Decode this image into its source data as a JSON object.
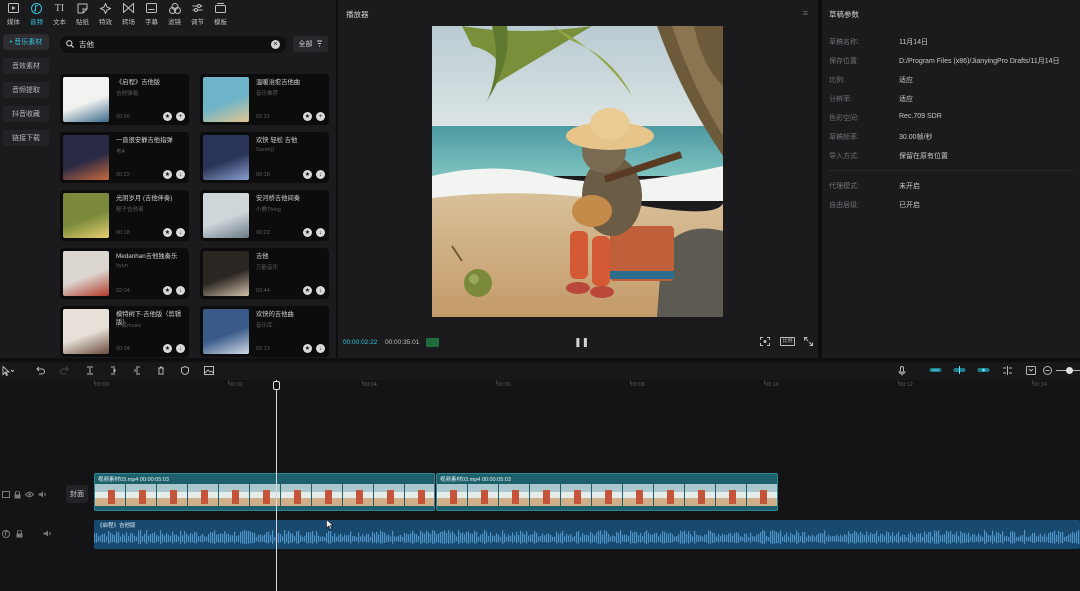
{
  "toolbar": {
    "items": [
      {
        "label": "媒体",
        "icon": "media-icon"
      },
      {
        "label": "音频",
        "icon": "audio-icon"
      },
      {
        "label": "文本",
        "icon": "text-icon"
      },
      {
        "label": "贴纸",
        "icon": "sticker-icon"
      },
      {
        "label": "特效",
        "icon": "effects-icon"
      },
      {
        "label": "转场",
        "icon": "transition-icon"
      },
      {
        "label": "字幕",
        "icon": "caption-icon"
      },
      {
        "label": "滤镜",
        "icon": "filter-icon"
      },
      {
        "label": "调节",
        "icon": "adjust-icon"
      },
      {
        "label": "模板",
        "icon": "template-icon"
      }
    ],
    "active_index": 1,
    "accent": "#33c6d8"
  },
  "sidebar": {
    "items": [
      "• 音乐素材",
      "音效素材",
      "音频提取",
      "抖音收藏",
      "链接下载"
    ]
  },
  "search": {
    "value": "吉他",
    "filter_label": "全部"
  },
  "media": {
    "cards": [
      {
        "title": "《启程》吉他版",
        "sub": "吉他弹唱",
        "dur": "00:56"
      },
      {
        "title": "温暖治愈吉他曲",
        "sub": "音乐推荐",
        "dur": "02:31"
      },
      {
        "title": "一直很安静吉他指弹",
        "sub": "老A",
        "dur": "00:22"
      },
      {
        "title": "欢快 轻松 吉他",
        "sub": "Sanm()",
        "dur": "00:16"
      },
      {
        "title": "光阴岁月 (吉他伴奏)",
        "sub": "郁子吉他谱",
        "dur": "00:18"
      },
      {
        "title": "安河桥吉他间奏",
        "sub": "小鹿Thing",
        "dur": "00:22"
      },
      {
        "title": "Medanhan吉他独奏乐",
        "sub": "hyun",
        "dur": "02:04"
      },
      {
        "title": "吉他",
        "sub": "万能音乐",
        "dur": "03:44"
      },
      {
        "title": "模特树下-吉他版（剪辑版）",
        "sub": "小黄music",
        "dur": "00:34"
      },
      {
        "title": "欢快的吉他曲",
        "sub": "音乐库",
        "dur": "02:13"
      }
    ]
  },
  "player": {
    "title": "播放器",
    "current_time": "00:00:02:22",
    "total_time": "00:00:35:01",
    "ratio_label": "比例"
  },
  "params": {
    "title": "草稿参数",
    "rows": [
      {
        "k": "草稿名称:",
        "v": "11月14日"
      },
      {
        "k": "保存位置:",
        "v": "D:/Program Files (x86)/JianyingPro Drafts/11月14日"
      },
      {
        "k": "比例:",
        "v": "适应"
      },
      {
        "k": "分辨率:",
        "v": "适应"
      },
      {
        "k": "色彩空间:",
        "v": "Rec.709 SDR"
      },
      {
        "k": "草稿帧率:",
        "v": "30.00帧/秒"
      },
      {
        "k": "导入方式:",
        "v": "保留在原有位置"
      },
      {
        "k": "代理模式:",
        "v": "未开启"
      },
      {
        "k": "自由层级:",
        "v": "已开启"
      }
    ]
  },
  "timeline": {
    "ticks": [
      "00:00",
      "00:02",
      "00:04",
      "00:06",
      "00:08",
      "00:10",
      "00:12",
      "00:14"
    ],
    "cover_label": "封面",
    "video_clips": [
      {
        "label": "视频素材03.mp4  00:00:05:03"
      },
      {
        "label": "视频素材03.mp4  00:00:05:03"
      }
    ],
    "audio_clip_label": "《启程》吉他版"
  }
}
